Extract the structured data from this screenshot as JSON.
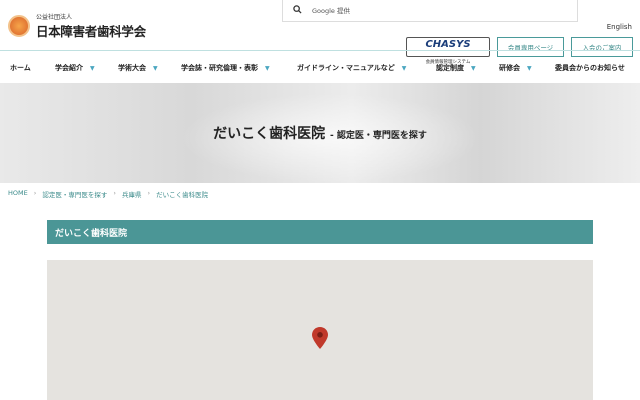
{
  "header": {
    "org_small": "公益社団法人",
    "org_name": "日本障害者歯科学会",
    "search_placeholder": "Google 提供",
    "english": "English",
    "chasys_title": "CHASYS",
    "chasys_sub": "会員情報管理システム",
    "member_page": "会員専用ページ",
    "join": "入会のご案内"
  },
  "nav": [
    "ホーム",
    "学会紹介",
    "学術大会",
    "学会誌・研究倫理・表彰",
    "ガイドライン・マニュアルなど",
    "認定制度",
    "研修会",
    "委員会からのお知らせ"
  ],
  "hero": {
    "title": "だいこく歯科医院",
    "subtitle": "- 認定医・専門医を探す"
  },
  "breadcrumb": [
    "HOME",
    "認定医・専門医を探す",
    "兵庫県",
    "だいこく歯科医院"
  ],
  "section_title": "だいこく歯科医院",
  "colors": {
    "accent": "#4b9696",
    "pin": "#c0392b"
  }
}
